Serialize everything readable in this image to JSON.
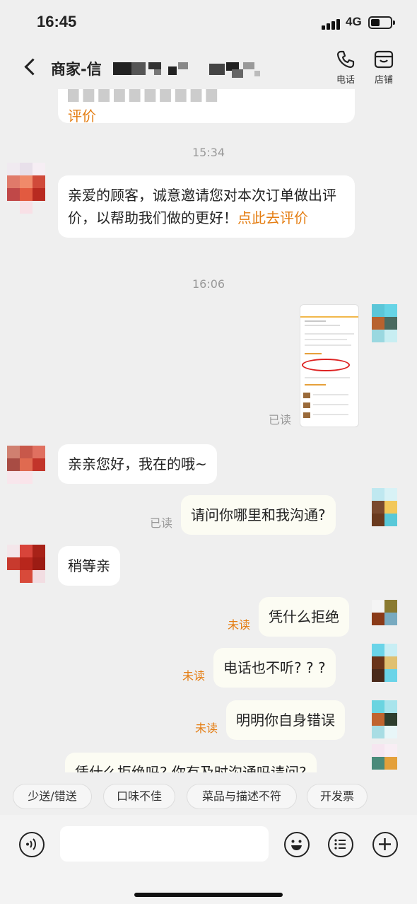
{
  "status_bar": {
    "time": "16:45",
    "network": "4G"
  },
  "header": {
    "back_icon": "chevron-left-icon",
    "title": "商家-信",
    "phone_label": "电话",
    "store_label": "店铺"
  },
  "messages": {
    "m1_line1": "评价",
    "ts1": "15:34",
    "m2_text": "亲爱的顾客，诚意邀请您对本次订单做出评价，以帮助我们做的更好！",
    "m2_link": "点此去评价",
    "ts2": "16:06",
    "m3_status": "已读",
    "m4_text": "亲亲您好，我在的哦~",
    "m5_text": "请问你哪里和我沟通?",
    "m5_status": "已读",
    "m6_text": "稍等亲",
    "m7_text": "凭什么拒绝",
    "m7_status": "未读",
    "m8_text": "电话也不听? ? ?",
    "m8_status": "未读",
    "m9_text": "明明你自身错误",
    "m9_status": "未读",
    "m10_text": "凭什么拒绝吗? 你有及时沟通吗请问?"
  },
  "quick_replies": [
    "少送/错送",
    "口味不佳",
    "菜品与描述不符",
    "开发票"
  ],
  "input": {
    "placeholder": ""
  },
  "colors": {
    "accent": "#e47d12",
    "bg": "#efefef",
    "own_bubble": "#fcfcf3"
  }
}
